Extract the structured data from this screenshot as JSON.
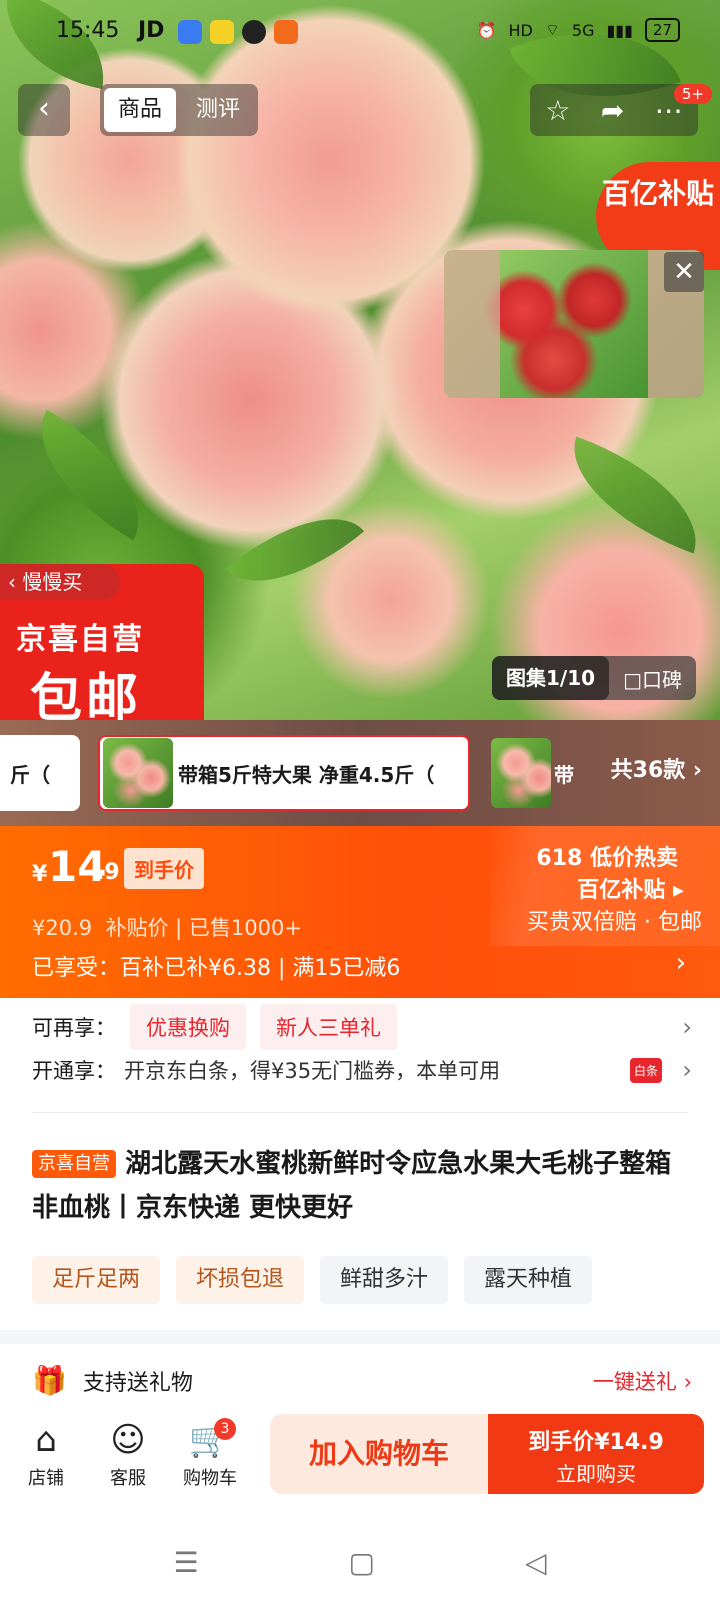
{
  "status": {
    "time": "15:45",
    "app": "JD",
    "battery": "27",
    "signal": "5G",
    "hd": "HD"
  },
  "header": {
    "tabs": [
      "商品",
      "测评"
    ],
    "badge": "5+"
  },
  "hero": {
    "subsidy_badge": "百亿补贴",
    "slow_buy": "慢慢买",
    "jx_line1": "京喜自营",
    "jx_line2": "包邮",
    "gallery_label": "图集1/10",
    "gallery_alt": "口碑"
  },
  "variants": {
    "left_partial": "斤（",
    "selected": "带箱5斤特大果 净重4.5斤（",
    "right_partial": "带",
    "count": "共36款"
  },
  "price": {
    "currency": "¥",
    "amount": "14",
    "decimal": ".9",
    "tag": "到手价",
    "original": "¥20.9",
    "subsidy_price": "补贴价",
    "sold": "已售1000+",
    "enjoyed": "已享受：百补已补¥6.38 | 满15已减6",
    "promo_line1": "618 低价热卖",
    "promo_line2": "百亿补贴",
    "promo_line3": "买贵双倍赔 · 包邮"
  },
  "promos": {
    "more_label": "可再享：",
    "chips": [
      "优惠换购",
      "新人三单礼"
    ],
    "open_label": "开通享：",
    "open_text": "开京东白条，得¥35无门槛券，本单可用"
  },
  "product": {
    "tag": "京喜自营",
    "title": "湖北露天水蜜桃新鲜时令应急水果大毛桃子整箱非血桃丨京东快递 更快更好",
    "tags_orange": [
      "足斤足两",
      "坏损包退"
    ],
    "tags_gray": [
      "鲜甜多汁",
      "露天种植"
    ]
  },
  "gift": {
    "label": "支持送礼物",
    "action": "一键送礼"
  },
  "bottom": {
    "items": [
      "店铺",
      "客服",
      "购物车"
    ],
    "cart_count": "3",
    "add_cart": "加入购物车",
    "buy_price": "到手价¥14.9",
    "buy_now": "立即购买"
  },
  "colors": {
    "accent": "#f13a14",
    "orange": "#ff5a0a",
    "red_chip": "#e8262d"
  }
}
